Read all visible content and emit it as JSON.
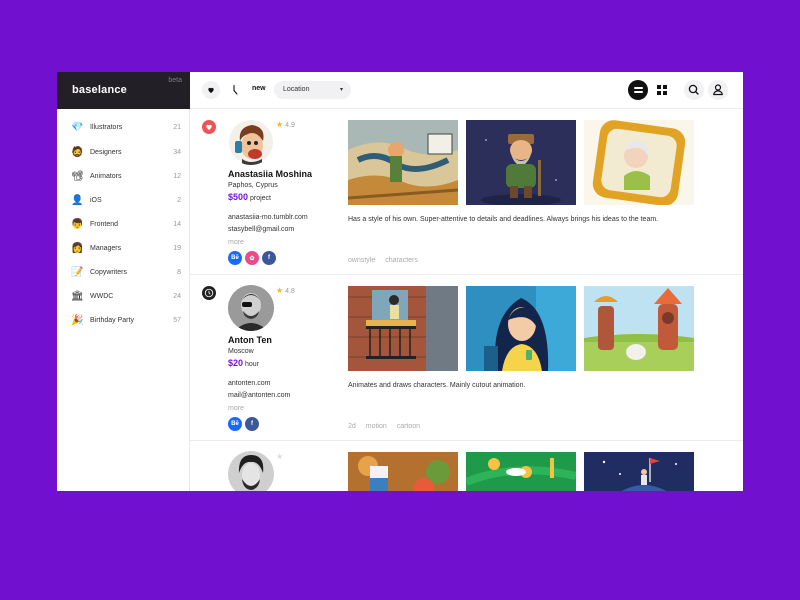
{
  "app": {
    "brand": "baselance",
    "beta": "beta"
  },
  "sidebar": {
    "items": [
      {
        "label": "Illustrators",
        "count": "21",
        "icon": "💎"
      },
      {
        "label": "Designers",
        "count": "34",
        "icon": "🧔"
      },
      {
        "label": "Animators",
        "count": "12",
        "icon": "📽"
      },
      {
        "label": "iOS",
        "count": "2",
        "icon": "👤"
      },
      {
        "label": "Frontend",
        "count": "14",
        "icon": "👦"
      },
      {
        "label": "Managers",
        "count": "19",
        "icon": "👩"
      },
      {
        "label": "Copywriters",
        "count": "8",
        "icon": "📝"
      },
      {
        "label": "WWDC",
        "count": "24",
        "icon": "🏛"
      },
      {
        "label": "Birthday Party",
        "count": "57",
        "icon": "🎉"
      }
    ]
  },
  "toolbar": {
    "new_label": "new",
    "location_label": "Location",
    "caret": "▾",
    "icons": [
      "heart-icon",
      "clock-icon",
      "list-view-icon",
      "grid-view-icon",
      "search-icon",
      "user-icon"
    ]
  },
  "cards": [
    {
      "name": "Anastasiia Moshina",
      "location": "Paphos, Cyprus",
      "price": "$500",
      "price_unit": "project",
      "rating": "4.9",
      "contact1": "anastasiia-mo.tumblr.com",
      "contact2": "stasybell@gmail.com",
      "more": "more",
      "description": "Has a style of his own. Super-attentive to details and deadlines. Always brings his ideas to the team.",
      "tags": [
        "ownstyle",
        "characters"
      ],
      "socials": [
        "Bē",
        "✿",
        "f"
      ],
      "badge_icon": "heart-icon"
    },
    {
      "name": "Anton Ten",
      "location": "Moscow",
      "price": "$20",
      "price_unit": "hour",
      "rating": "4.8",
      "contact1": "antonten.com",
      "contact2": "mail@antonten.com",
      "more": "more",
      "description": "Animates and draws characters. Mainly cutout animation.",
      "tags": [
        "2d",
        "motion",
        "cartoon"
      ],
      "socials": [
        "Bē",
        "f"
      ],
      "badge_icon": "clock-icon"
    }
  ],
  "colors": {
    "accent": "#7210cf",
    "price": "#7a14d6",
    "heart": "#ef5358",
    "star": "#f5b524",
    "behance": "#1769ff",
    "dribbble": "#ea4c89",
    "facebook": "#3b5998"
  }
}
